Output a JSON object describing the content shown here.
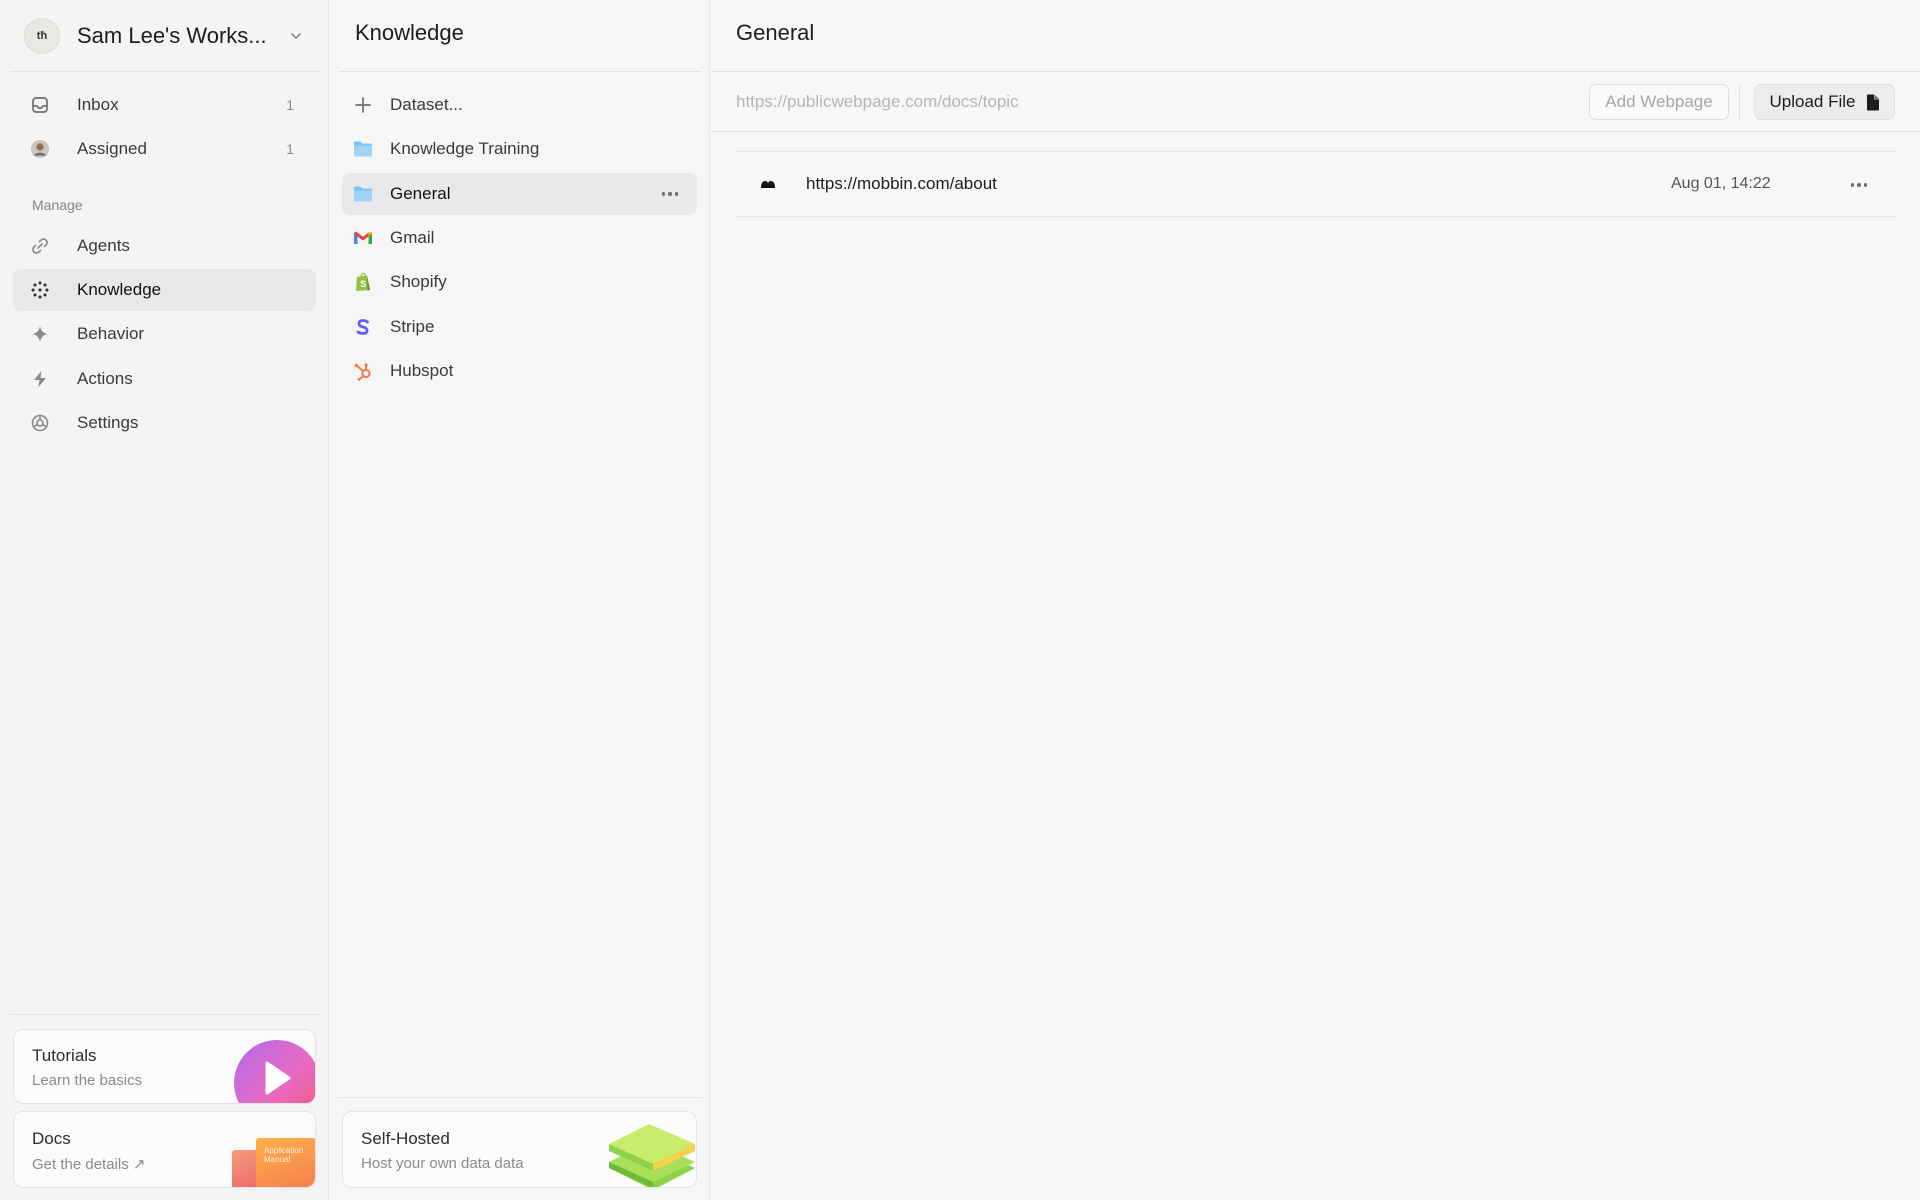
{
  "workspace": {
    "initials": "tħ",
    "name": "Sam Lee's Works..."
  },
  "nav": {
    "inbox": {
      "label": "Inbox",
      "count": "1"
    },
    "assigned": {
      "label": "Assigned",
      "count": "1"
    },
    "manage_label": "Manage",
    "agents": "Agents",
    "knowledge": "Knowledge",
    "behavior": "Behavior",
    "actions": "Actions",
    "settings": "Settings"
  },
  "cards": {
    "tutorials": {
      "title": "Tutorials",
      "subtitle": "Learn the basics"
    },
    "docs": {
      "title": "Docs",
      "subtitle": "Get the details ↗",
      "book_text": "Application Manual"
    },
    "self_hosted": {
      "title": "Self-Hosted",
      "subtitle": "Host your own data data"
    }
  },
  "knowledge": {
    "title": "Knowledge",
    "items": [
      {
        "label": "Dataset...",
        "icon": "plus-icon"
      },
      {
        "label": "Knowledge Training",
        "icon": "folder-icon"
      },
      {
        "label": "General",
        "icon": "folder-icon",
        "active": true
      },
      {
        "label": "Gmail",
        "icon": "gmail-icon"
      },
      {
        "label": "Shopify",
        "icon": "shopify-icon"
      },
      {
        "label": "Stripe",
        "icon": "stripe-icon"
      },
      {
        "label": "Hubspot",
        "icon": "hubspot-icon"
      }
    ]
  },
  "main": {
    "title": "General",
    "url_placeholder": "https://publicwebpage.com/docs/topic",
    "add_webpage_label": "Add Webpage",
    "upload_file_label": "Upload File",
    "rows": [
      {
        "url": "https://mobbin.com/about",
        "date": "Aug 01, 14:22"
      }
    ]
  },
  "colors": {
    "folder": "#7cc4f2",
    "stripe": "#635bff",
    "hubspot": "#f27b45",
    "shopify": "#95bf47",
    "tutorial_gradient": [
      "#b46bf0",
      "#f0587a"
    ]
  }
}
